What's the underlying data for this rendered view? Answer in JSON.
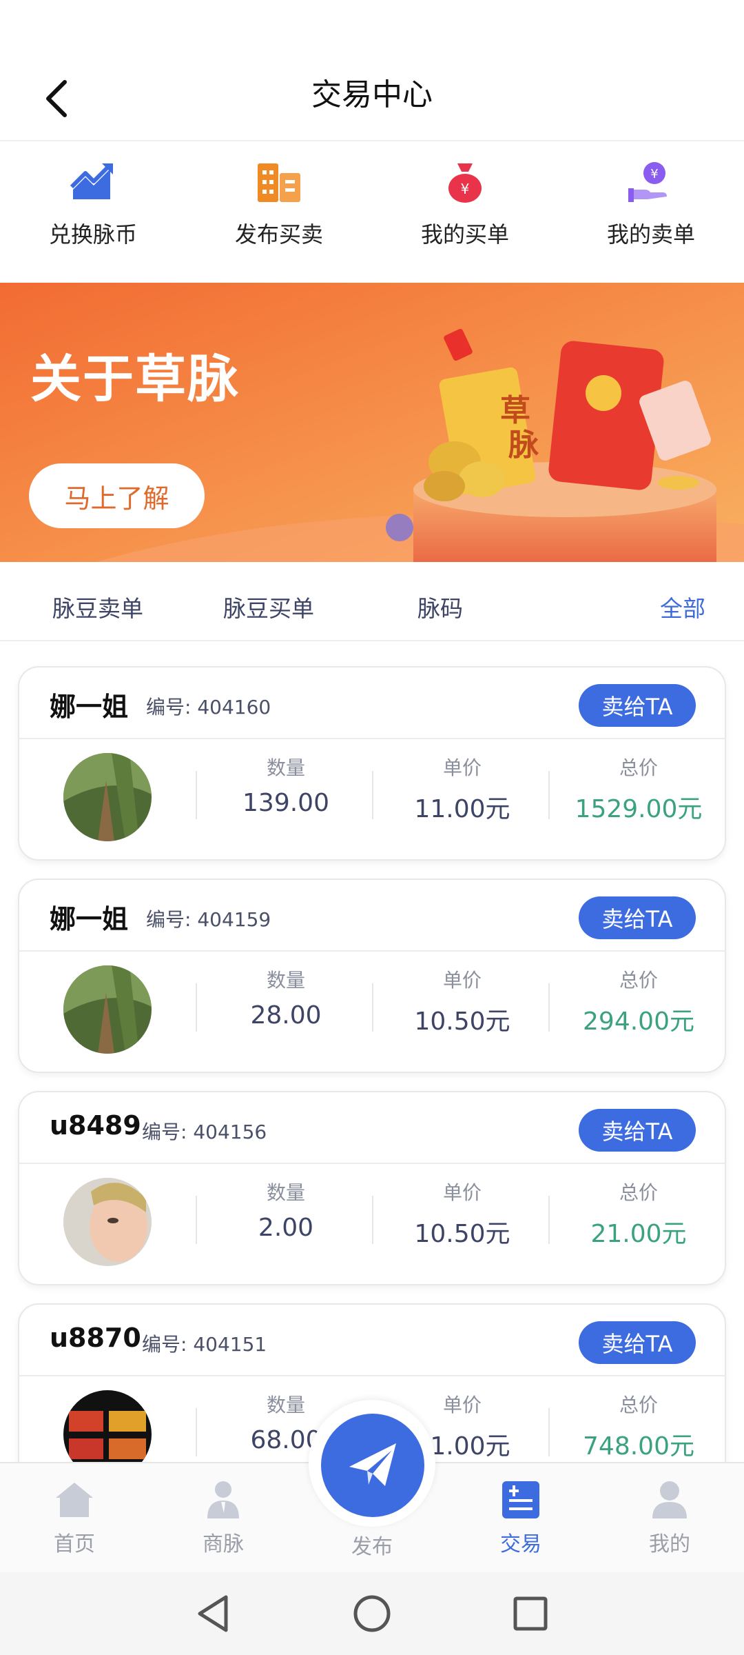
{
  "header": {
    "title": "交易中心",
    "back_icon": "chevron-left-icon"
  },
  "quick_actions": [
    {
      "label": "兑换脉币",
      "icon": "trend-chart-icon",
      "color": "#3d6be0"
    },
    {
      "label": "发布买卖",
      "icon": "buildings-icon",
      "color": "#f08a24"
    },
    {
      "label": "我的买单",
      "icon": "money-bag-icon",
      "color": "#e8334a"
    },
    {
      "label": "我的卖单",
      "icon": "hand-coin-icon",
      "color": "#8a5cf0"
    }
  ],
  "banner": {
    "title": "关于草脉",
    "button": "马上了解",
    "packet_text": "草脉"
  },
  "tabs": [
    {
      "label": "脉豆卖单"
    },
    {
      "label": "脉豆买单"
    },
    {
      "label": "脉码"
    },
    {
      "label": "全部"
    }
  ],
  "columns": {
    "qty": "数量",
    "price": "单价",
    "total": "总价"
  },
  "orders": [
    {
      "name": "娜一姐",
      "number": "编号: 404160",
      "button": "卖给TA",
      "qty": "139.00",
      "price": "11.00元",
      "total": "1529.00元"
    },
    {
      "name": "娜一姐",
      "number": "编号: 404159",
      "button": "卖给TA",
      "qty": "28.00",
      "price": "10.50元",
      "total": "294.00元"
    },
    {
      "name": "u8489",
      "number": "编号: 404156",
      "button": "卖给TA",
      "qty": "2.00",
      "price": "10.50元",
      "total": "21.00元"
    },
    {
      "name": "u8870",
      "number": "编号: 404151",
      "button": "卖给TA",
      "qty": "68.00",
      "price": "11.00元",
      "total": "748.00元"
    }
  ],
  "bottom_nav": [
    {
      "label": "首页",
      "icon": "home-icon"
    },
    {
      "label": "商脉",
      "icon": "person-icon"
    },
    {
      "label": "发布",
      "icon": "paper-plane-icon"
    },
    {
      "label": "交易",
      "icon": "exchange-icon",
      "active": true
    },
    {
      "label": "我的",
      "icon": "user-icon"
    }
  ],
  "colors": {
    "accent": "#3d6be0",
    "total": "#3aa27e",
    "banner": "#f37f3c"
  }
}
